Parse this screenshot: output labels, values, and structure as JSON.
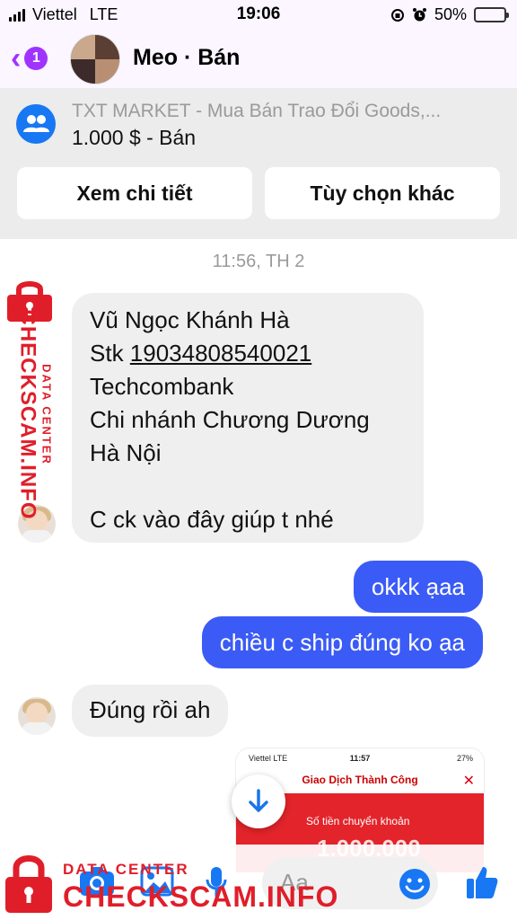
{
  "status_bar": {
    "carrier": "Viettel",
    "network": "LTE",
    "time": "19:06",
    "battery": "50%",
    "battery_level": 0.5
  },
  "header": {
    "back_badge": "1",
    "title": "Meo · Bán",
    "icons": [
      "chevron-left-icon",
      "group-avatar"
    ]
  },
  "listing": {
    "group_name": "TXT MARKET - Mua Bán Trao Đổi Goods,...",
    "price": "1.000 $ - Bán",
    "view_details_label": "Xem chi tiết",
    "more_options_label": "Tùy chọn khác"
  },
  "chat": {
    "timestamp": "11:56, TH 2",
    "incoming_1": {
      "line1": "Vũ Ngọc Khánh Hà",
      "stk_prefix": "Stk ",
      "account_number": "19034808540021",
      "line3": "Techcombank",
      "line4": "Chi nhánh Chương Dương",
      "line5": "Hà Nội",
      "line6": "C ck vào đây giúp t nhé"
    },
    "outgoing_1": "okkk ạaa",
    "outgoing_2": "chiều c ship đúng ko ạa",
    "incoming_2": "Đúng rồi ah",
    "attachment": {
      "status_carrier": "Viettel  LTE",
      "status_time": "11:57",
      "status_battery": "27%",
      "title": "Giao Dịch Thành Công",
      "label": "Số tiền chuyển khoản",
      "amount": "1.000.000"
    }
  },
  "composer": {
    "placeholder": "Aa",
    "icons": [
      "camera-icon",
      "image-icon",
      "microphone-icon",
      "emoji-icon",
      "thumbs-up-icon"
    ]
  },
  "watermark": {
    "small_text": "DATA CENTER",
    "big_text": "CHECKSCAM.INFO"
  },
  "colors": {
    "accent_purple": "#a033ff",
    "messenger_blue": "#3b5bf6",
    "facebook_blue": "#1877f2",
    "watermark_red": "#e01e2a"
  }
}
